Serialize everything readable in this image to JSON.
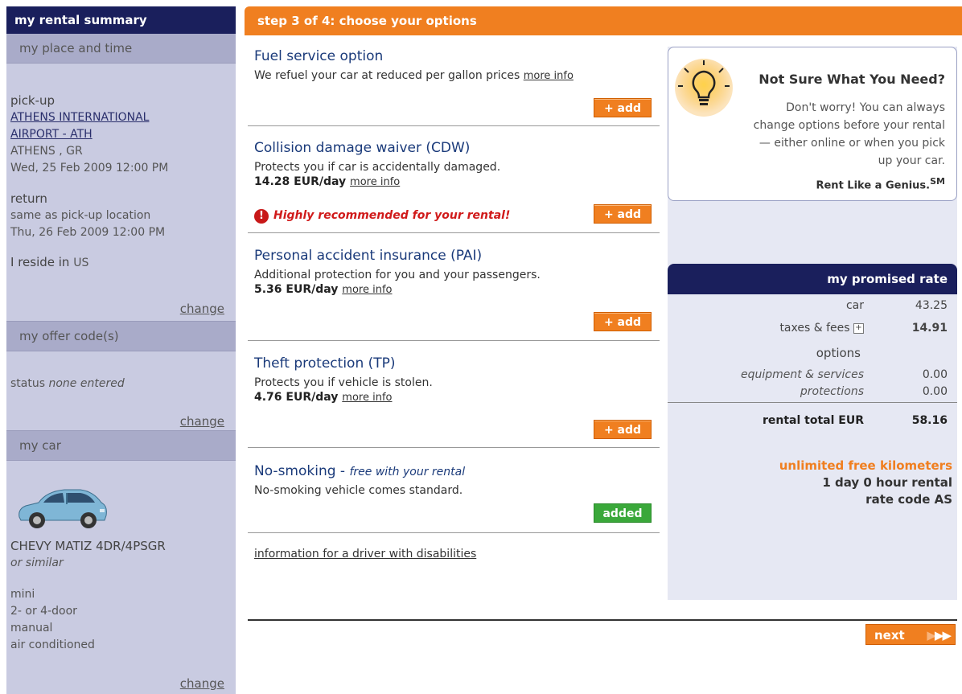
{
  "sidebar": {
    "title": "my rental summary",
    "place_time": {
      "heading": "my place and time",
      "pickup_label": "pick-up",
      "pickup_location_line1": "ATHENS INTERNATIONAL",
      "pickup_location_line2": "AIRPORT - ATH",
      "pickup_city": "ATHENS ,  GR",
      "pickup_datetime": "Wed, 25 Feb 2009 12:00 PM",
      "return_label": "return",
      "return_location": "same as pick-up location",
      "return_datetime": "Thu, 26 Feb 2009 12:00 PM",
      "reside_label": "I reside in",
      "reside_country": "US",
      "change": "change"
    },
    "offer": {
      "heading": "my offer code(s)",
      "status_label": "status",
      "status_value": "none entered",
      "change": "change"
    },
    "car": {
      "heading": "my car",
      "model": "CHEVY MATIZ 4DR/4PSGR",
      "similar": "or similar",
      "specs": [
        "mini",
        "2- or 4-door",
        "manual",
        "air conditioned"
      ],
      "change": "change"
    }
  },
  "step_bar": "step 3 of 4: choose your options",
  "options": [
    {
      "title": "Fuel service option",
      "desc": "We refuel your car at reduced per gallon prices",
      "more": "more info",
      "button": "+ add"
    },
    {
      "title": "Collision damage waiver (CDW)",
      "desc": "Protects you if car is accidentally damaged.",
      "price": "14.28 EUR/day",
      "more": "more info",
      "recommend": "Highly recommended for your rental!",
      "button": "+ add"
    },
    {
      "title": "Personal accident insurance (PAI)",
      "desc": "Additional protection for you and your passengers.",
      "price": "5.36 EUR/day",
      "more": "more info",
      "button": "+ add"
    },
    {
      "title": "Theft protection (TP)",
      "desc": "Protects you if vehicle is stolen.",
      "price": "4.76 EUR/day",
      "more": "more info",
      "button": "+ add"
    },
    {
      "title": "No-smoking",
      "title_suffix": " - ",
      "free_note": "free with your rental",
      "desc": "No-smoking vehicle comes standard.",
      "button": "added"
    }
  ],
  "disabilities_link": "information for a driver with disabilities",
  "tip": {
    "title": "Not Sure What You Need?",
    "text": "Don't worry! You can always change options before your rental — either online or when you pick up your car.",
    "slogan": "Rent Like a Genius.",
    "slogan_mark": "SM"
  },
  "rate": {
    "heading": "my promised rate",
    "car_label": "car",
    "car_value": "43.25",
    "taxes_label": "taxes & fees",
    "taxes_value": "14.91",
    "options_label": "options",
    "equipment_label": "equipment & services",
    "equipment_value": "0.00",
    "protections_label": "protections",
    "protections_value": "0.00",
    "total_label": "rental total EUR",
    "total_value": "58.16",
    "kms": "unlimited free kilometers",
    "duration": "1 day 0 hour rental",
    "rate_code": "rate code AS"
  },
  "next_button": "next",
  "colors": {
    "navy": "#1a1f5c",
    "orange": "#f07f20",
    "sidebar_bg": "#c9cbe1",
    "green": "#3aa83a",
    "alert_red": "#d01a1a"
  }
}
